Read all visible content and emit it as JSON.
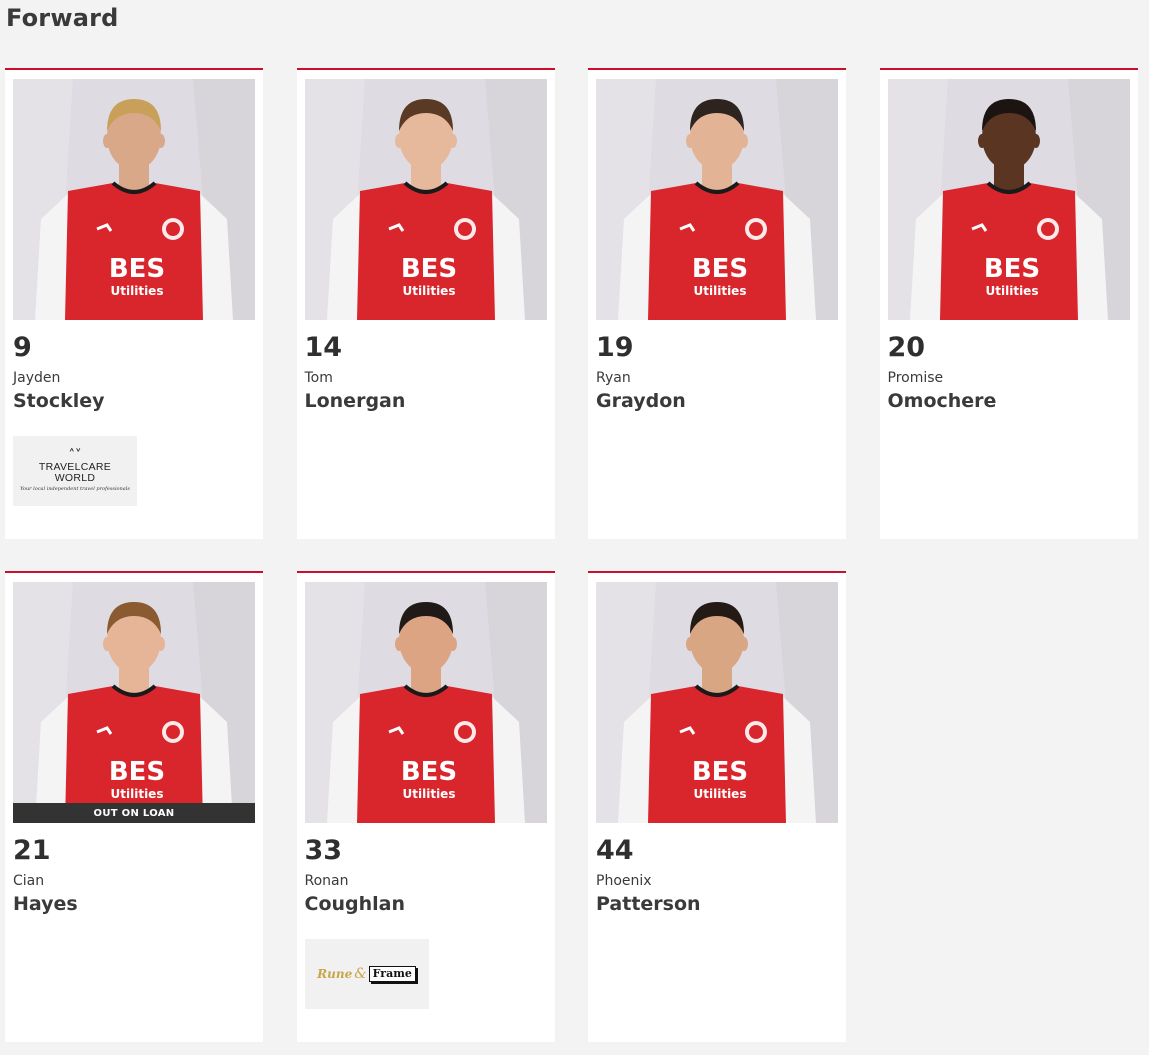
{
  "section": {
    "title": "Forward"
  },
  "colors": {
    "accent": "#c8102e",
    "shirt": "#d9262c",
    "sleeve": "#f4f4f4"
  },
  "players": [
    {
      "number": "9",
      "first_name": "Jayden",
      "last_name": "Stockley",
      "loan": false,
      "sponsor": "travelcare",
      "skin": "#d9a889",
      "hair": "#c9a05a"
    },
    {
      "number": "14",
      "first_name": "Tom",
      "last_name": "Lonergan",
      "loan": false,
      "sponsor": "",
      "skin": "#e7b99c",
      "hair": "#5a3a24"
    },
    {
      "number": "19",
      "first_name": "Ryan",
      "last_name": "Graydon",
      "loan": false,
      "sponsor": "",
      "skin": "#e2b394",
      "hair": "#2d2420"
    },
    {
      "number": "20",
      "first_name": "Promise",
      "last_name": "Omochere",
      "loan": false,
      "sponsor": "",
      "skin": "#5a3522",
      "hair": "#1b1410"
    },
    {
      "number": "21",
      "first_name": "Cian",
      "last_name": "Hayes",
      "loan": true,
      "sponsor": "",
      "skin": "#e6b497",
      "hair": "#8a5a30"
    },
    {
      "number": "33",
      "first_name": "Ronan",
      "last_name": "Coughlan",
      "loan": false,
      "sponsor": "runeframe",
      "skin": "#dca483",
      "hair": "#1f1a18"
    },
    {
      "number": "44",
      "first_name": "Phoenix",
      "last_name": "Patterson",
      "loan": false,
      "sponsor": "",
      "skin": "#d9a683",
      "hair": "#231a16"
    }
  ],
  "badges": {
    "loan": "OUT ON LOAN"
  },
  "kit": {
    "sponsor_line1": "BES",
    "sponsor_line2": "Utilities"
  },
  "sponsors": {
    "travelcare": {
      "line1": "TRAVELCARE",
      "line2": "WORLD",
      "tagline": "Your local independent travel professionals"
    },
    "runeframe": {
      "part1": "Rune",
      "amp": "&",
      "part2": "Frame"
    }
  }
}
